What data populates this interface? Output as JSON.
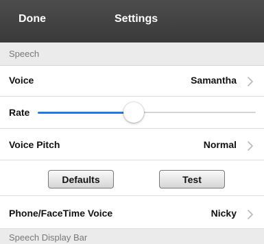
{
  "navbar": {
    "done_label": "Done",
    "title": "Settings",
    "background": "#3f3f3f"
  },
  "sections": {
    "speech": "Speech",
    "speech_display_bar": "Speech Display Bar"
  },
  "voice": {
    "label": "Voice",
    "value": "Samantha"
  },
  "rate": {
    "label": "Rate",
    "level_fraction": 0.44,
    "accent": "#1f7ae6"
  },
  "voice_pitch": {
    "label": "Voice Pitch",
    "value": "Normal"
  },
  "actions": {
    "defaults_label": "Defaults",
    "test_label": "Test"
  },
  "phone_voice": {
    "label": "Phone/FaceTime Voice",
    "value": "Nicky"
  },
  "icons": {
    "disclosure": "chevron-right-icon"
  }
}
